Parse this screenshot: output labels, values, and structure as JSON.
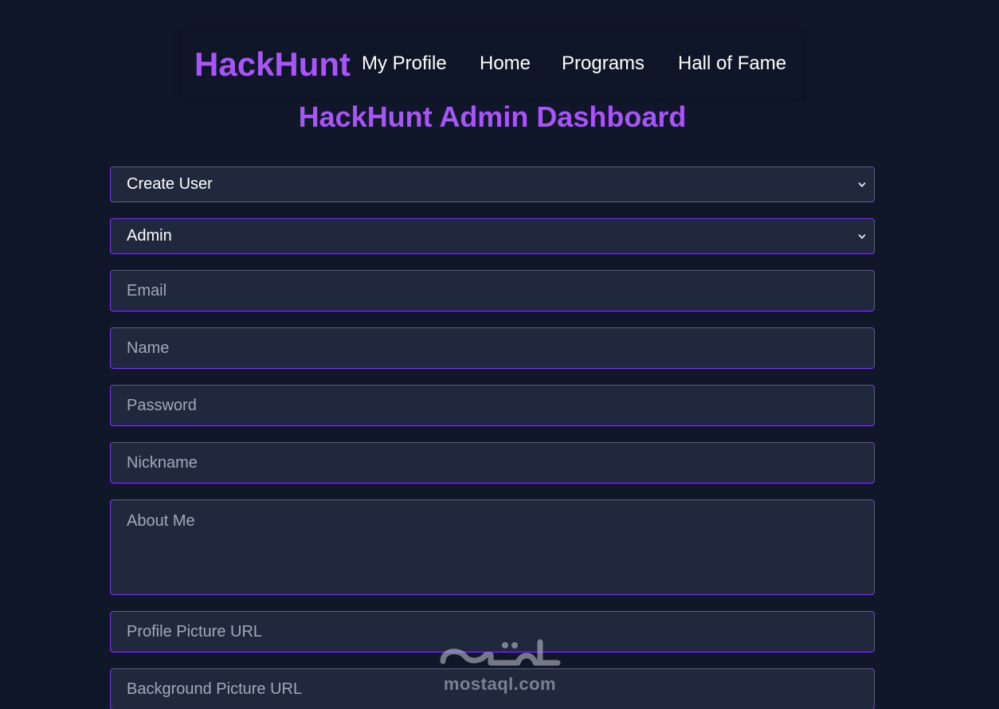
{
  "nav": {
    "brand": "HackHunt",
    "links": [
      "My Profile",
      "Home",
      "Programs",
      "Hall of Fame"
    ]
  },
  "page_title": "HackHunt Admin Dashboard",
  "form": {
    "action_select": {
      "selected": "Create User"
    },
    "role_select": {
      "selected": "Admin"
    },
    "email": {
      "placeholder": "Email",
      "value": ""
    },
    "name": {
      "placeholder": "Name",
      "value": ""
    },
    "password": {
      "placeholder": "Password",
      "value": ""
    },
    "nickname": {
      "placeholder": "Nickname",
      "value": ""
    },
    "about_me": {
      "placeholder": "About Me",
      "value": ""
    },
    "profile_picture_url": {
      "placeholder": "Profile Picture URL",
      "value": ""
    },
    "background_picture_url": {
      "placeholder": "Background Picture URL",
      "value": ""
    }
  },
  "watermark": {
    "text": "mostaql.com"
  },
  "colors": {
    "background": "#101729",
    "accent": "#a855f7",
    "field_border": "#7c3aed",
    "field_background": "#1f283d"
  },
  "icons": {
    "dropdown": "chevron-down-icon"
  }
}
